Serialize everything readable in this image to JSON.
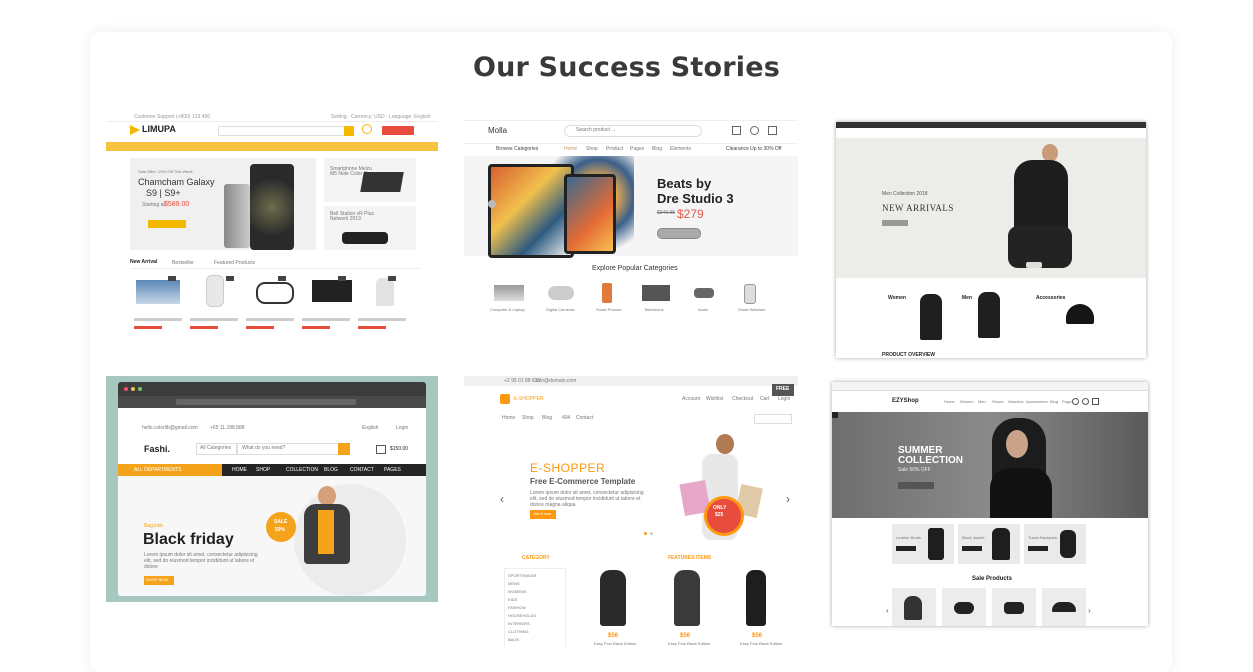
{
  "section": {
    "title": "Our Success Stories"
  },
  "limupa": {
    "logo": "LIMUPA",
    "hero_kicker": "Sale Offer -20% Off This Week",
    "hero_title_1": "Chamcham Galaxy",
    "hero_title_2": "S9 | S9+",
    "hero_price_label": "Starting at",
    "hero_price": "$589.00",
    "promo1_title": "Smartphone Meizu M5 Note Color Green",
    "promo2_title": "Bell Station vR Plus Network 2019",
    "tab_active": "New Arrival",
    "tab2": "Bestseller",
    "tab3": "Featured Products",
    "badges": [
      "new",
      "new",
      "new",
      "new",
      "new"
    ]
  },
  "molla": {
    "logo": "Molla",
    "search_placeholder": "Search product ...",
    "nav": [
      "Home",
      "Shop",
      "Product",
      "Pages",
      "Blog",
      "Elements"
    ],
    "browse": "Browse Categories",
    "clearance": "Clearance Up to 30% Off",
    "hero_title_1": "Beats by",
    "hero_title_2": "Dre Studio 3",
    "hero_old_price": "$349.95",
    "hero_price": "$279",
    "hero_btn": "SHOP NOW",
    "categories_title": "Explore Popular Categories",
    "categories": [
      "Computer & Laptop",
      "Digital Cameras",
      "Smart Phones",
      "Televisions",
      "Audio",
      "Smart Watches"
    ]
  },
  "fashion": {
    "kicker": "Men Collection 2018",
    "title": "NEW ARRIVALS",
    "btn": "SHOP NOW",
    "categories": [
      "Women",
      "Men",
      "Accessories"
    ],
    "overview": "PRODUCT OVERVIEW"
  },
  "fashi": {
    "logo": "Fashi.",
    "email": "hello.colorlib@gmail.com",
    "phone": "+65 11.188.888",
    "language": "English",
    "login": "Login",
    "all_categories": "All Categories",
    "search_placeholder": "What do you need?",
    "cart_total": "$150.00",
    "menu": [
      "ALL DEPARTMENTS",
      "HOME",
      "SHOP",
      "COLLECTION",
      "BLOG",
      "CONTACT",
      "PAGES"
    ],
    "kicker": "Bag,kids",
    "title": "Black friday",
    "text": "Lorem ipsum dolor sit amet, consectetur adipisicing elit, sed do eiusmod tempor incididunt ut labore et dolore",
    "btn": "SHOP NOW",
    "sale_1": "SALE",
    "sale_2": "50%"
  },
  "eshopper": {
    "logo": "E-SHOPPER",
    "phone": "+2 95 01 88 821",
    "email": "info@domain.com",
    "free_badge": "FREE",
    "nav": [
      "Home",
      "Shop",
      "Blog",
      "404",
      "Contact"
    ],
    "account": "Account",
    "wishlist": "Wishlist",
    "checkout": "Checkout",
    "cart": "Cart",
    "login": "Login",
    "hero_logo_e": "E",
    "hero_logo_rest": "-SHOPPER",
    "hero_title": "Free E-Commerce Template",
    "hero_text": "Lorem ipsum dolor sit amet, consectetur adipisicing elit, sed do eiusmod tempor incididunt ut labore et dolore magna aliqua.",
    "hero_btn": "Get it now",
    "bag_text_1": "ONLY",
    "bag_text_2": "$25",
    "category_title": "CATEGORY",
    "featured_title": "FEATURES ITEMS",
    "categories": [
      "SPORTSWEAR",
      "MENS",
      "WOMENS",
      "KIDS",
      "FASHION",
      "HOUSEHOLDS",
      "INTERIORS",
      "CLOTHING",
      "BAGS"
    ],
    "prices": [
      "$56",
      "$56",
      "$56"
    ],
    "product_name": "Easy Polo Black Edition"
  },
  "ezyshop": {
    "logo": "EZYShop",
    "nav": [
      "Home",
      "Women",
      "Men",
      "Shoes",
      "Watches",
      "Accessories",
      "Blog",
      "Pages"
    ],
    "hero_title_1": "SUMMER",
    "hero_title_2": "COLLECTION",
    "hero_sub": "Sale 50% OFF",
    "hero_btn": "SHOP NOW",
    "products": [
      "Leather Boots",
      "Black Jacket",
      "Travel Backpack"
    ],
    "product_btn": "SHOP NOW",
    "sale_title": "Sale Products"
  }
}
